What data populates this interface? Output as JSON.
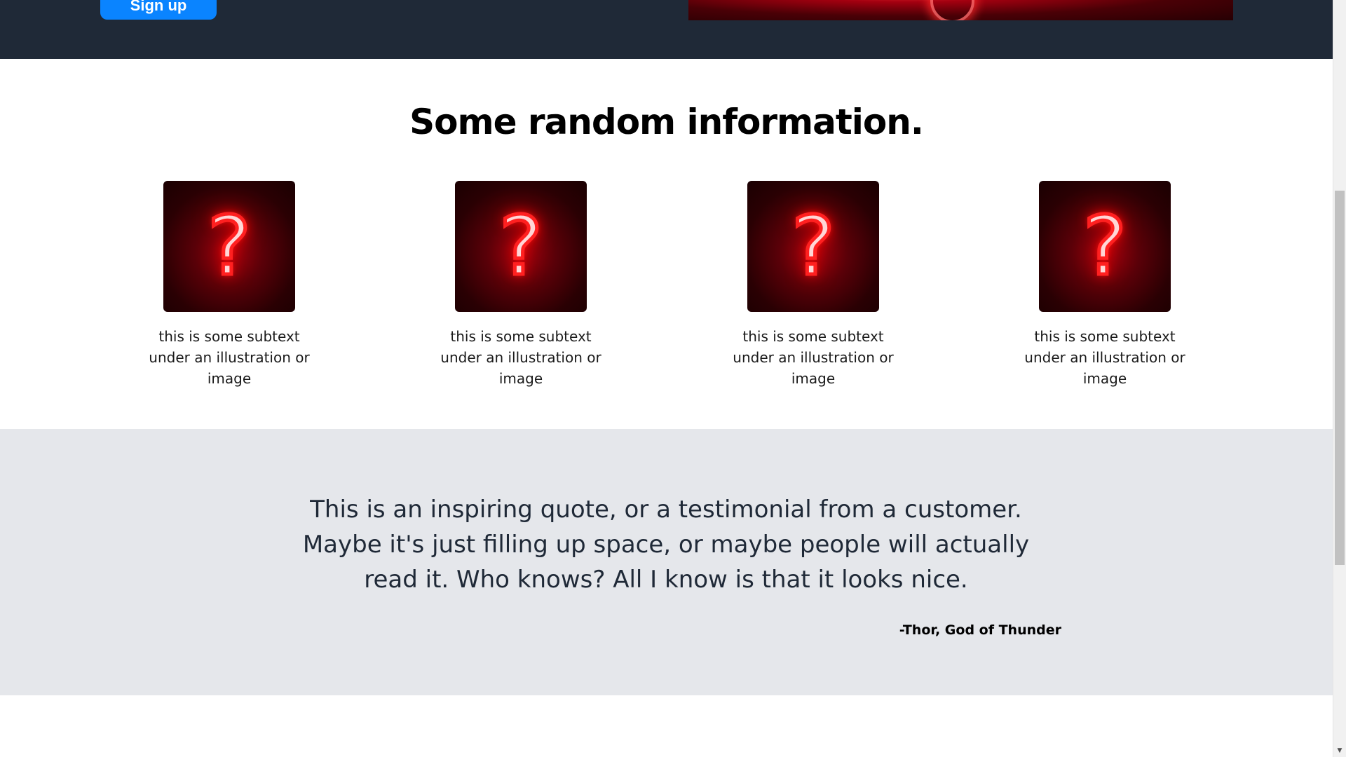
{
  "hero": {
    "signup_label": "Sign up",
    "background_color": "#1f2937",
    "button_color": "#0a84ff"
  },
  "info": {
    "title": "Some random information.",
    "cards": [
      {
        "image_icon": "neon-question-mark",
        "caption": "this is some subtext under an illustration or image"
      },
      {
        "image_icon": "neon-question-mark",
        "caption": "this is some subtext under an illustration or image"
      },
      {
        "image_icon": "neon-question-mark",
        "caption": "this is some subtext under an illustration or image"
      },
      {
        "image_icon": "neon-question-mark",
        "caption": "this is some subtext under an illustration or image"
      }
    ]
  },
  "quote": {
    "text": "This is an inspiring quote, or a testimonial from a customer. Maybe it's just filling up space, or maybe people will actually read it. Who knows? All I know is that it looks nice.",
    "author": "-Thor, God of Thunder",
    "background_color": "#e5e7eb"
  },
  "scrollbar": {
    "down_arrow_icon": "triangle-down-icon"
  }
}
